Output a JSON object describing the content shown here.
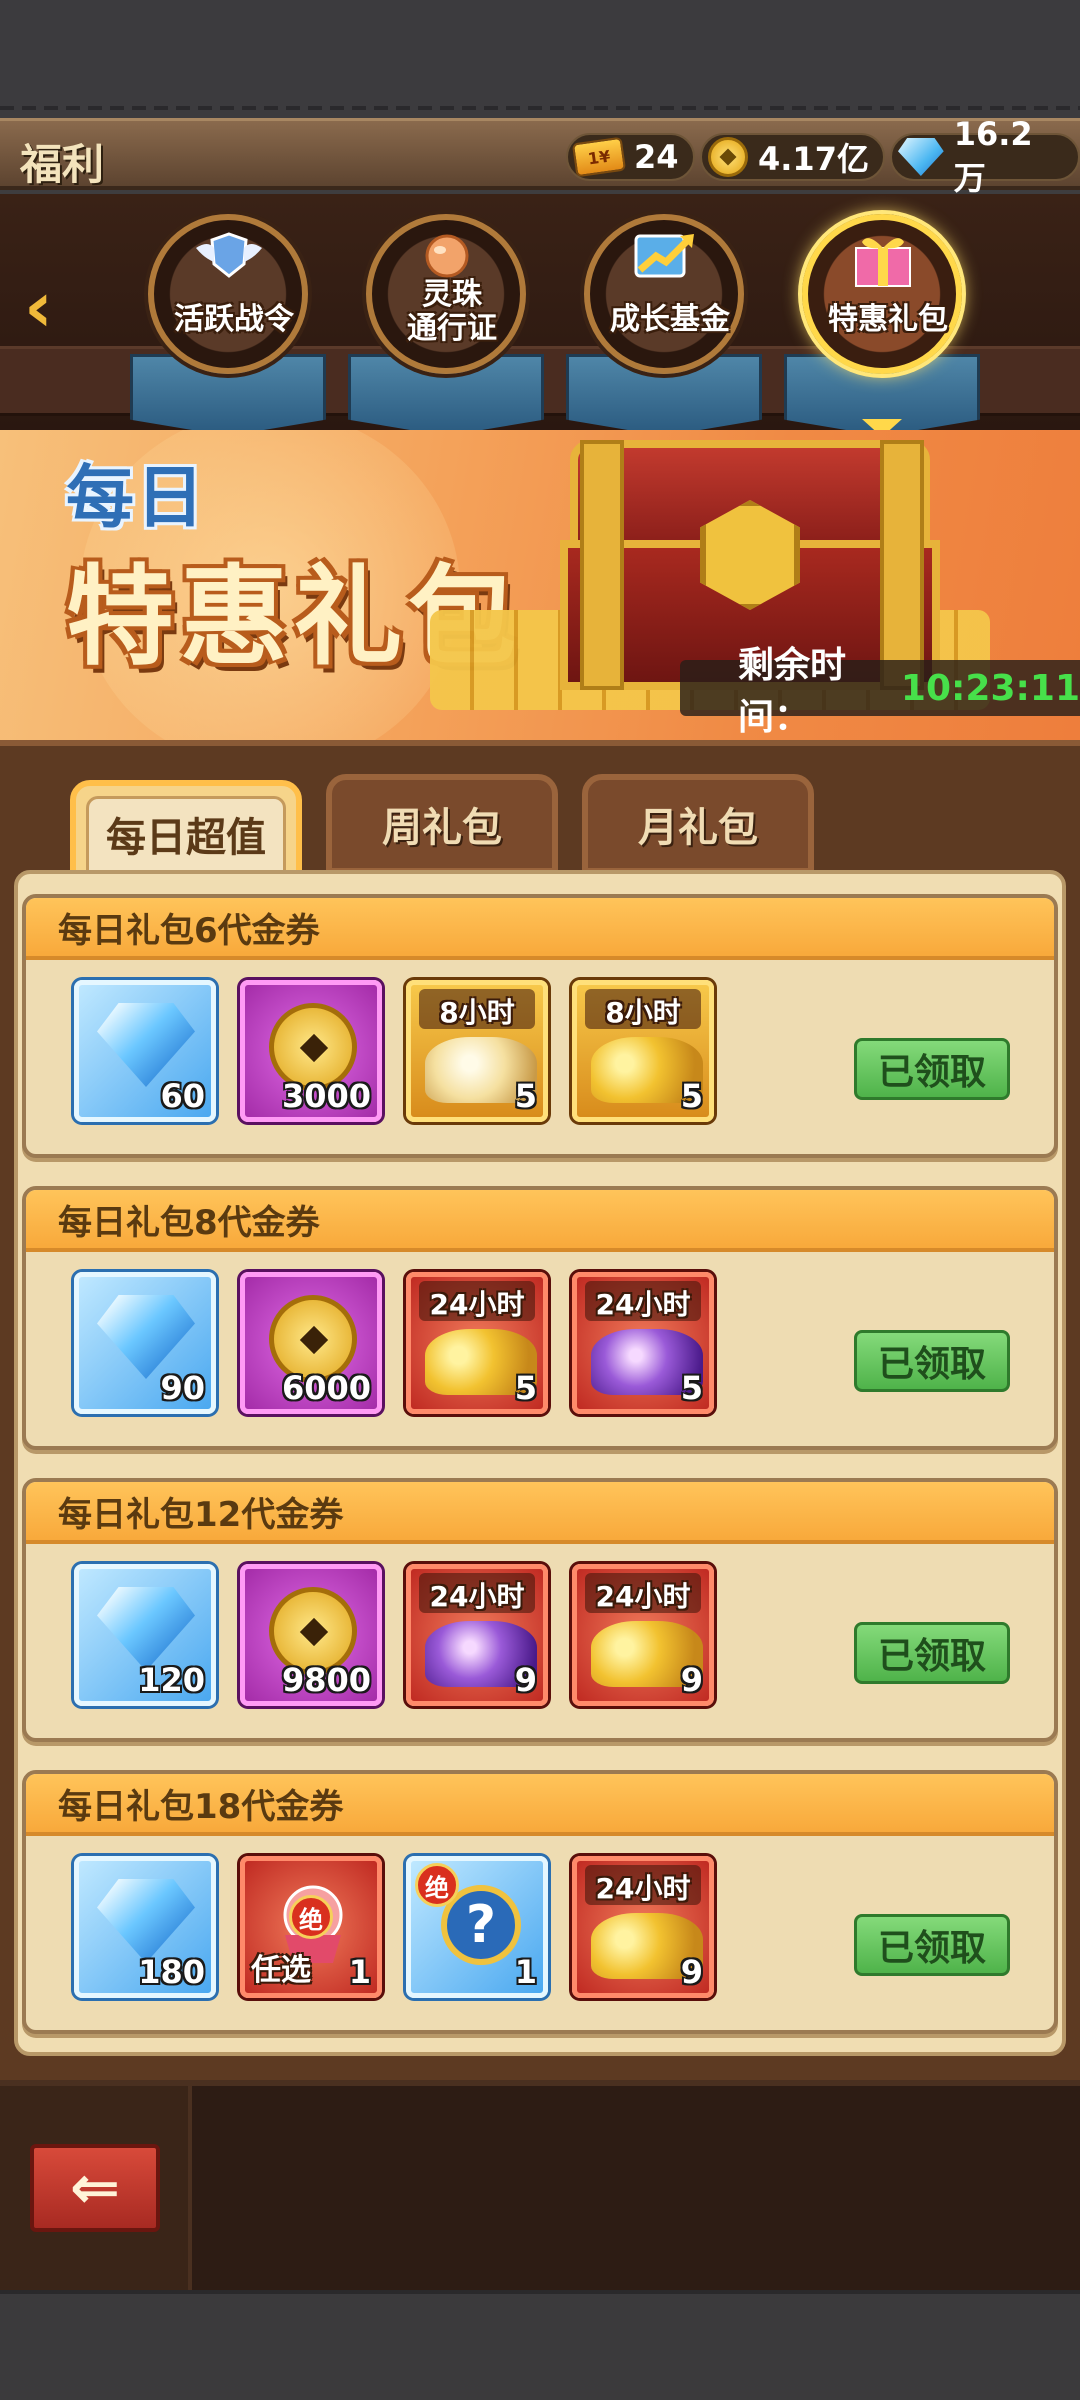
{
  "header": {
    "title": "福利",
    "resources": [
      {
        "icon": "ticket-icon",
        "value": "24"
      },
      {
        "icon": "coin-icon",
        "value": "4.17亿"
      },
      {
        "icon": "diamond-icon",
        "value": "16.2万"
      }
    ],
    "ticket_text": "1¥"
  },
  "nav": {
    "items": [
      {
        "label": "活跃战令",
        "active": false
      },
      {
        "label": "灵珠\n通行证",
        "active": false
      },
      {
        "label": "成长基金",
        "active": false
      },
      {
        "label": "特惠礼包",
        "active": true
      }
    ]
  },
  "banner": {
    "daily": "每日",
    "title": "特惠礼包",
    "timer_label": "剩余时间：",
    "timer_value": "10:23:11"
  },
  "tabs": [
    {
      "label": "每日超值",
      "active": true
    },
    {
      "label": "周礼包",
      "active": false
    },
    {
      "label": "月礼包",
      "active": false
    }
  ],
  "packs": [
    {
      "title": "每日礼包6代金券",
      "button": "已领取",
      "items": [
        {
          "type": "diamond",
          "qty": "60"
        },
        {
          "type": "coin",
          "qty": "3000"
        },
        {
          "type": "white-coins",
          "tag": "8小时",
          "qty": "5"
        },
        {
          "type": "gold-pile",
          "tag": "8小时",
          "qty": "5"
        }
      ]
    },
    {
      "title": "每日礼包8代金券",
      "button": "已领取",
      "items": [
        {
          "type": "diamond",
          "qty": "90"
        },
        {
          "type": "coin",
          "qty": "6000"
        },
        {
          "type": "gold-pile-red",
          "tag": "24小时",
          "qty": "5"
        },
        {
          "type": "purple-pile-red",
          "tag": "24小时",
          "qty": "5"
        }
      ]
    },
    {
      "title": "每日礼包12代金券",
      "button": "已领取",
      "items": [
        {
          "type": "diamond",
          "qty": "120"
        },
        {
          "type": "coin",
          "qty": "9800"
        },
        {
          "type": "purple-pile-red",
          "tag": "24小时",
          "qty": "9"
        },
        {
          "type": "gold-pile-red",
          "tag": "24小时",
          "qty": "9"
        }
      ]
    },
    {
      "title": "每日礼包18代金券",
      "button": "已领取",
      "items": [
        {
          "type": "diamond",
          "qty": "180"
        },
        {
          "type": "choice-box",
          "badge": "绝",
          "choice": "任选",
          "qty": "1"
        },
        {
          "type": "mystery-coin",
          "badge": "绝",
          "qty": "1"
        },
        {
          "type": "gold-pile-red",
          "tag": "24小时",
          "qty": "9"
        }
      ]
    }
  ],
  "colors": {
    "claimed_button": "#4fb34a",
    "timer_value": "#47e04a",
    "card_header": "#f8a93b"
  }
}
